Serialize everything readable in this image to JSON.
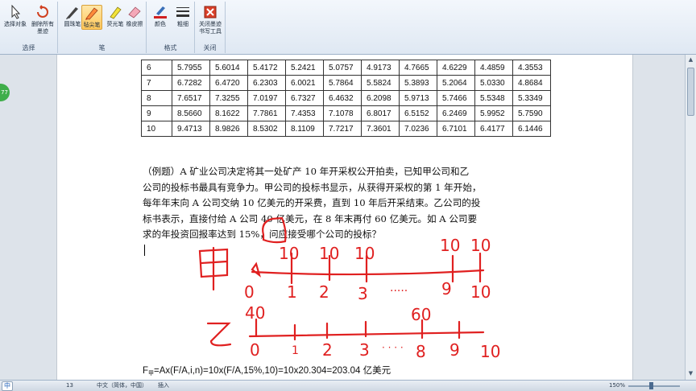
{
  "ribbon": {
    "groups": [
      {
        "label": "选择",
        "tools": [
          {
            "label": "选择对象",
            "icon": "cursor-icon"
          },
          {
            "label": "删除所有墨迹",
            "icon": "undo-erase-icon"
          }
        ]
      },
      {
        "label": "笔",
        "tools": [
          {
            "label": "圆珠笔",
            "icon": "ballpoint-pen-icon"
          },
          {
            "label": "毡尖笔",
            "icon": "felt-tip-pen-icon",
            "active": true
          },
          {
            "label": "荧光笔",
            "icon": "highlighter-icon"
          },
          {
            "label": "橡皮擦",
            "icon": "eraser-icon"
          }
        ]
      },
      {
        "label": "格式",
        "tools": [
          {
            "label": "颜色",
            "icon": "pen-color-icon"
          },
          {
            "label": "粗细",
            "icon": "thickness-icon"
          }
        ]
      },
      {
        "label": "关闭",
        "tools": [
          {
            "label": "关闭墨迹书写工具",
            "icon": "close-ink-tools-icon"
          }
        ]
      }
    ]
  },
  "side_badge": "77",
  "table": {
    "rows": [
      [
        "6",
        "5.7955",
        "5.6014",
        "5.4172",
        "5.2421",
        "5.0757",
        "4.9173",
        "4.7665",
        "4.6229",
        "4.4859",
        "4.3553"
      ],
      [
        "7",
        "6.7282",
        "6.4720",
        "6.2303",
        "6.0021",
        "5.7864",
        "5.5824",
        "5.3893",
        "5.2064",
        "5.0330",
        "4.8684"
      ],
      [
        "8",
        "7.6517",
        "7.3255",
        "7.0197",
        "6.7327",
        "6.4632",
        "6.2098",
        "5.9713",
        "5.7466",
        "5.5348",
        "5.3349"
      ],
      [
        "9",
        "8.5660",
        "8.1622",
        "7.7861",
        "7.4353",
        "7.1078",
        "6.8017",
        "6.5152",
        "6.2469",
        "5.9952",
        "5.7590"
      ],
      [
        "10",
        "9.4713",
        "8.9826",
        "8.5302",
        "8.1109",
        "7.7217",
        "7.3601",
        "7.0236",
        "6.7101",
        "6.4177",
        "6.1446"
      ]
    ]
  },
  "example": {
    "lines": [
      "（例题）A 矿业公司决定将其一处矿产 10 年开采权公开拍卖，已知甲公司和乙",
      "公司的投标书最具有竞争力。甲公司的投标书显示，从获得开采权的第 1 年开始，",
      "每年年末向 A 公司交纳 10 亿美元的开采费，直到 10 年后开采结束。乙公司的投",
      "标书表示，直接付给 A 公司 40 亿美元，在 8 年末再付 60 亿美元。如 A 公司要",
      "求的年投资回报率达到 15%，问应接受哪个公司的投标？"
    ]
  },
  "ink": {
    "jia": "甲",
    "yi": "乙",
    "jia_top": [
      "10",
      "10",
      "10",
      "10",
      "10"
    ],
    "jia_bottom": [
      "0",
      "1",
      "2",
      "3",
      "·····",
      "9",
      "10"
    ],
    "yi_top": [
      "40",
      "60"
    ],
    "yi_bottom": [
      "0",
      "1",
      "2",
      "3",
      "· · · ·",
      "8",
      "9",
      "10"
    ],
    "circled": "15%"
  },
  "formula": {
    "prefix": "F",
    "sub": "甲",
    "body": "=Ax(F/A,i,n)=10x(F/A,15%,10)=10x20.304=203.04 亿美元"
  },
  "status": {
    "ime": "中",
    "page": "13",
    "language": "中文（简体，中国）",
    "mode": "插入",
    "zoom": "150%"
  },
  "colors": {
    "ink": "#e02020",
    "ribbon_active": "#ffc75a"
  }
}
